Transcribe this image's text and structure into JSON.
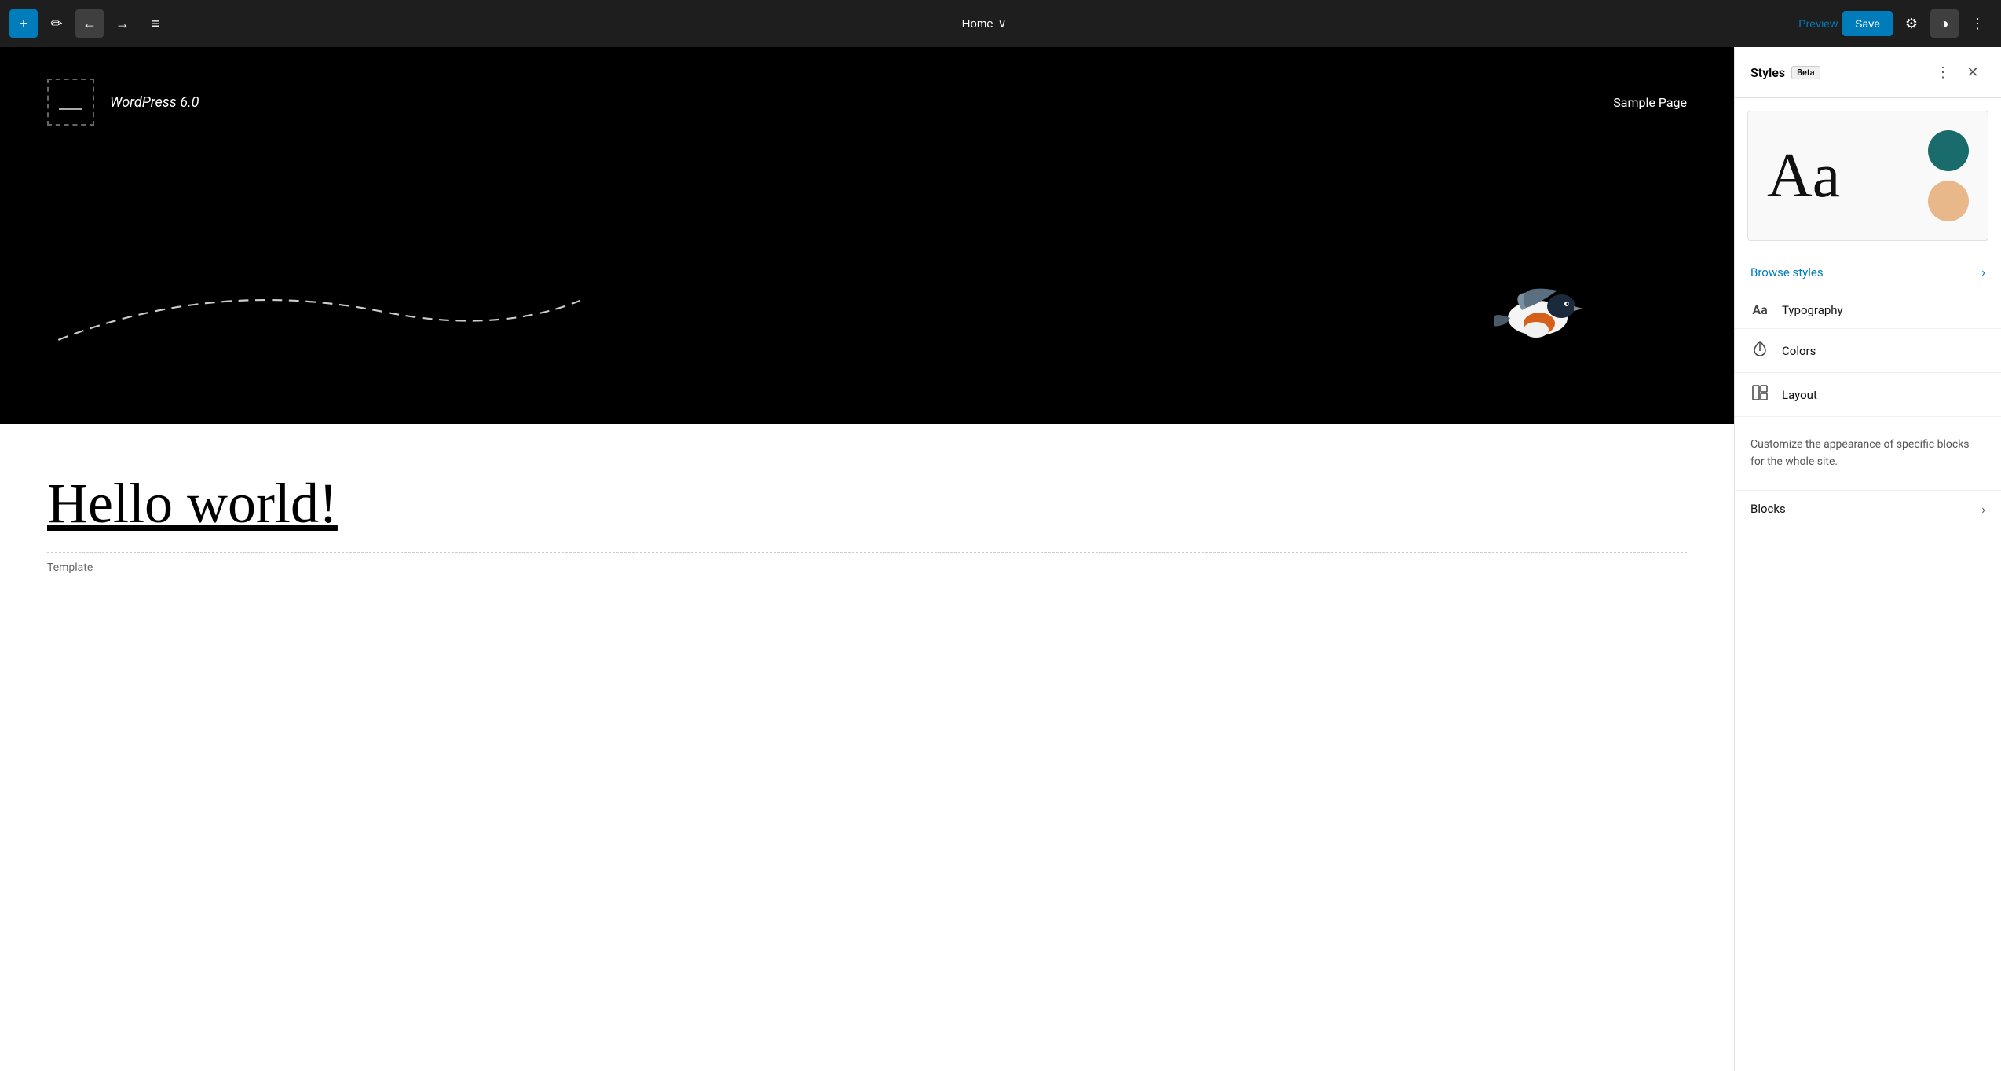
{
  "toolbar": {
    "add_label": "+",
    "edit_icon": "✏",
    "undo_icon": "←",
    "redo_icon": "→",
    "menu_icon": "≡",
    "page_title": "Home",
    "chevron_down": "∨",
    "preview_label": "Preview",
    "save_label": "Save",
    "settings_icon": "⚙",
    "dark_mode_icon": "◑",
    "more_icon": "⋮"
  },
  "canvas": {
    "site_title": "WordPress 6.0",
    "site_nav": "Sample Page",
    "hero_heading": "Hello world!",
    "template_label": "Template"
  },
  "sidebar": {
    "title": "Styles",
    "beta_label": "Beta",
    "more_icon": "⋮",
    "close_icon": "✕",
    "color_dark": "#1a6b6b",
    "color_light": "#e8b88a",
    "browse_styles_label": "Browse styles",
    "menu_items": [
      {
        "icon": "Aa",
        "label": "Typography",
        "id": "typography"
      },
      {
        "icon": "💧",
        "label": "Colors",
        "id": "colors"
      },
      {
        "icon": "▦",
        "label": "Layout",
        "id": "layout"
      }
    ],
    "customize_text": "Customize the appearance of specific blocks for the whole site.",
    "blocks_label": "Blocks"
  }
}
